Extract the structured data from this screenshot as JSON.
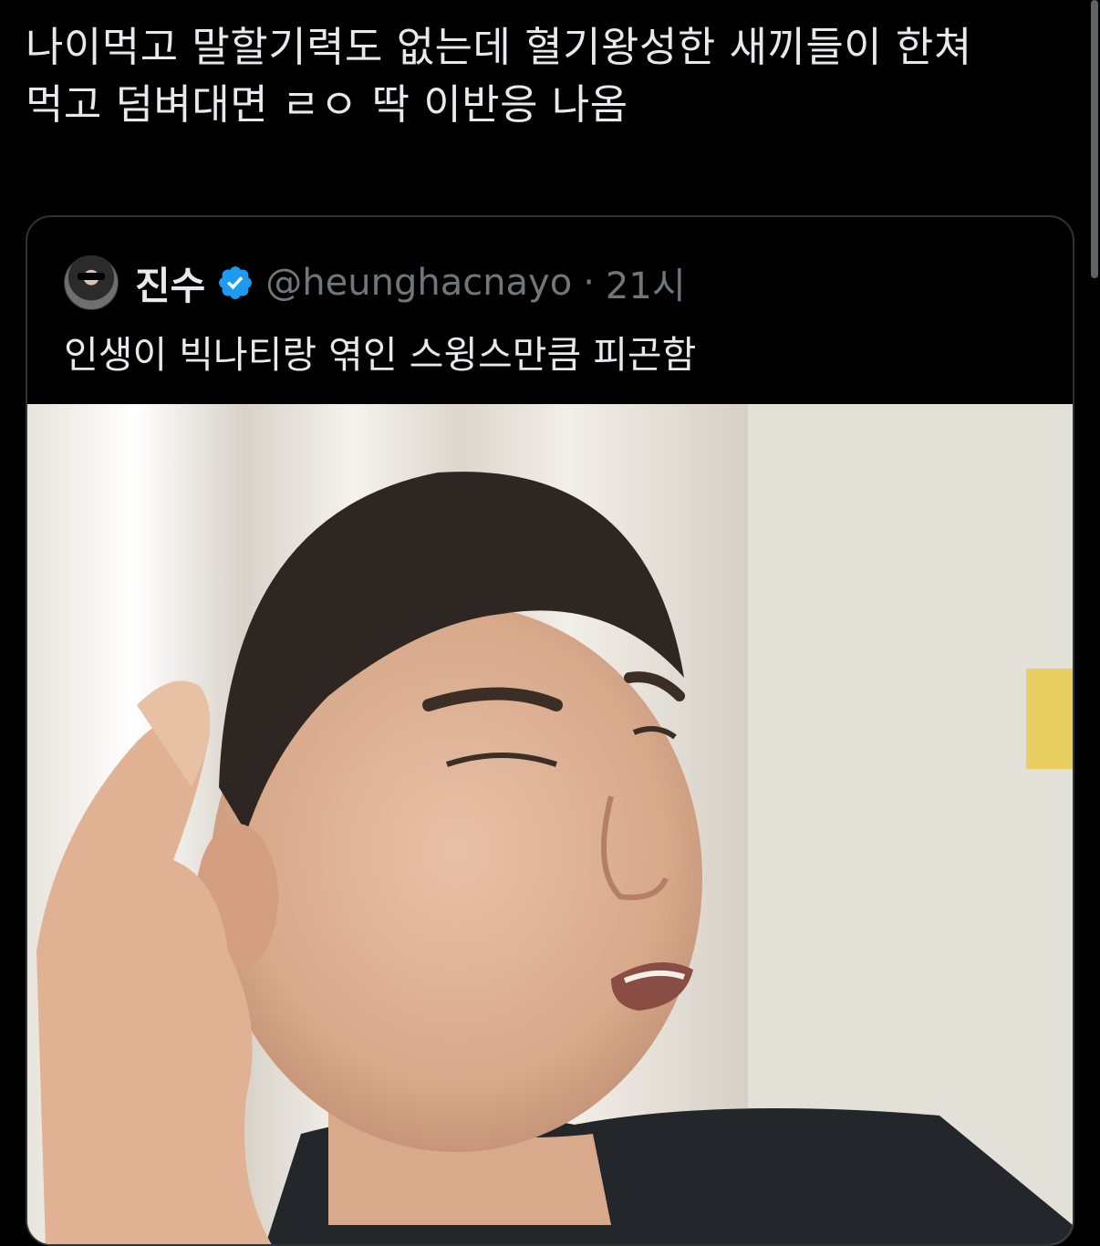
{
  "post": {
    "text": "나이먹고 말할기력도 없는데 혈기왕성한 새끼들이 한쳐\n먹고 덤벼대면 ㄹㅇ 딱 이반응 나옴"
  },
  "quoted_post": {
    "display_name": "진수",
    "handle": "@heunghacnayo",
    "separator": "·",
    "time": "21시",
    "text": "인생이 빅나티랑 엮인 스윙스만큼 피곤함",
    "verified": true,
    "media_icon": "photo-of-man-gesturing"
  },
  "colors": {
    "background": "#000000",
    "text": "#e7e9ea",
    "muted": "#71767b",
    "verified": "#1d9bf0",
    "border": "#2f3336"
  }
}
